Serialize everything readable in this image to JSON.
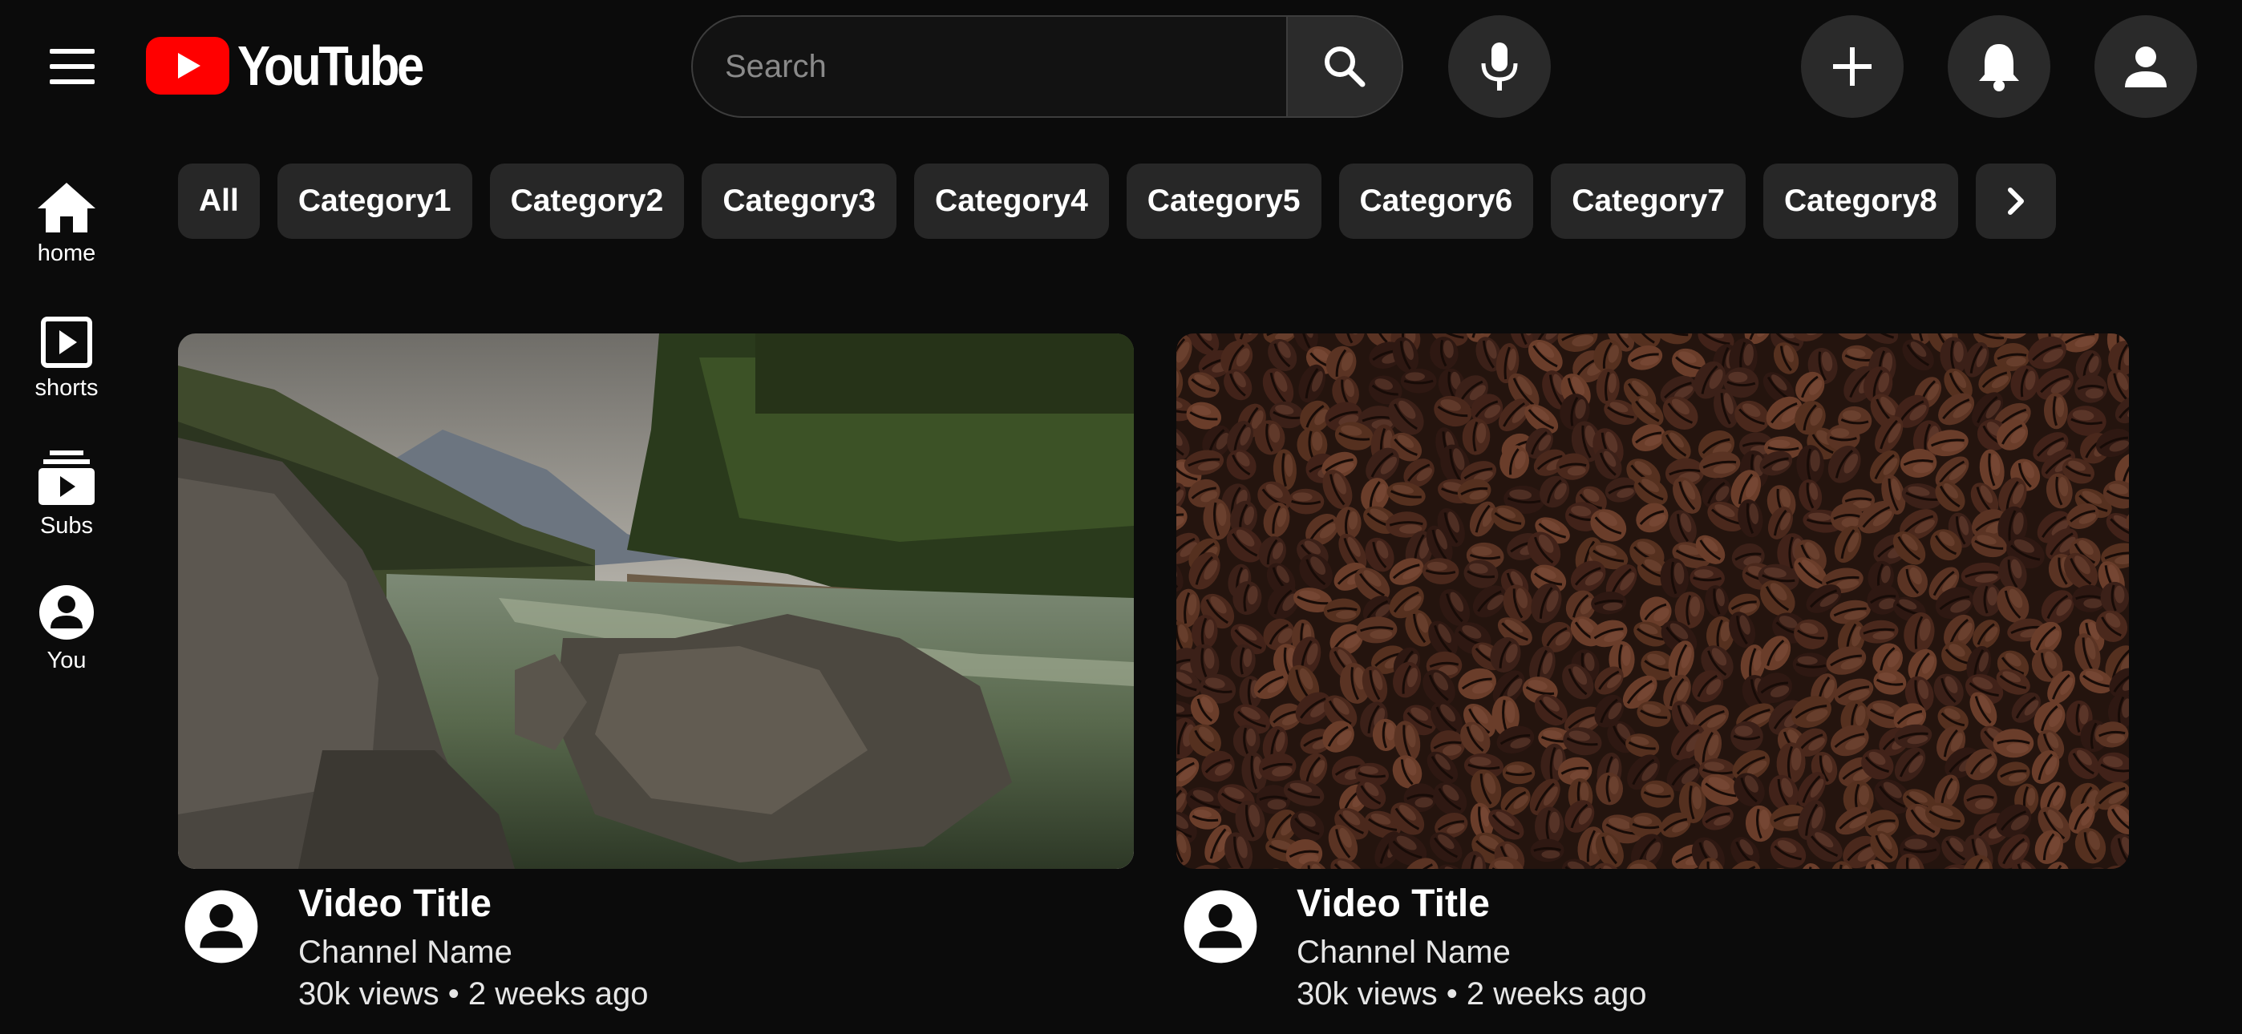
{
  "header": {
    "logo_text": "YouTube",
    "brand_color": "#ff0000",
    "search_placeholder": "Search",
    "icons": [
      "menu-icon",
      "search-icon",
      "mic-icon",
      "plus-icon",
      "bell-icon",
      "account-icon"
    ]
  },
  "sidebar": {
    "items": [
      {
        "label": "home",
        "icon": "home-icon"
      },
      {
        "label": "shorts",
        "icon": "shorts-icon"
      },
      {
        "label": "Subs",
        "icon": "subscriptions-icon"
      },
      {
        "label": "You",
        "icon": "you-icon"
      }
    ]
  },
  "chips": {
    "items": [
      "All",
      "Category1",
      "Category2",
      "Category3",
      "Category4",
      "Category5",
      "Category6",
      "Category7",
      "Category8"
    ],
    "next_icon": "chevron-right-icon"
  },
  "videos": [
    {
      "title": "Video Title",
      "channel": "Channel Name",
      "meta": "30k views • 2 weeks ago",
      "thumbnail": "river-landscape"
    },
    {
      "title": "Video Title",
      "channel": "Channel Name",
      "meta": "30k views • 2 weeks ago",
      "thumbnail": "coffee-beans"
    }
  ]
}
